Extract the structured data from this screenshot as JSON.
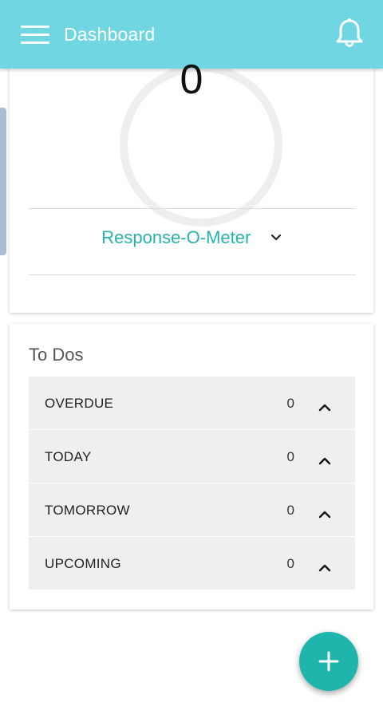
{
  "appbar": {
    "title": "Dashboard",
    "color": "#6fd6e2",
    "menu_icon": "hamburger-menu-icon",
    "notification_icon": "bell-icon"
  },
  "response_card": {
    "gauge_value": "0",
    "meter_label": "Response-O-Meter",
    "meter_icon": "chevron-down-icon",
    "accent_color": "#26b3ad"
  },
  "todos": {
    "title": "To Dos",
    "items": [
      {
        "label": "OVERDUE",
        "count": "0",
        "icon": "chevron-up-icon"
      },
      {
        "label": "TODAY",
        "count": "0",
        "icon": "chevron-up-icon"
      },
      {
        "label": "TOMORROW",
        "count": "0",
        "icon": "chevron-up-icon"
      },
      {
        "label": "UPCOMING",
        "count": "0",
        "icon": "chevron-up-icon"
      }
    ]
  },
  "fab": {
    "icon": "plus-icon",
    "color": "#1fb5ad"
  }
}
